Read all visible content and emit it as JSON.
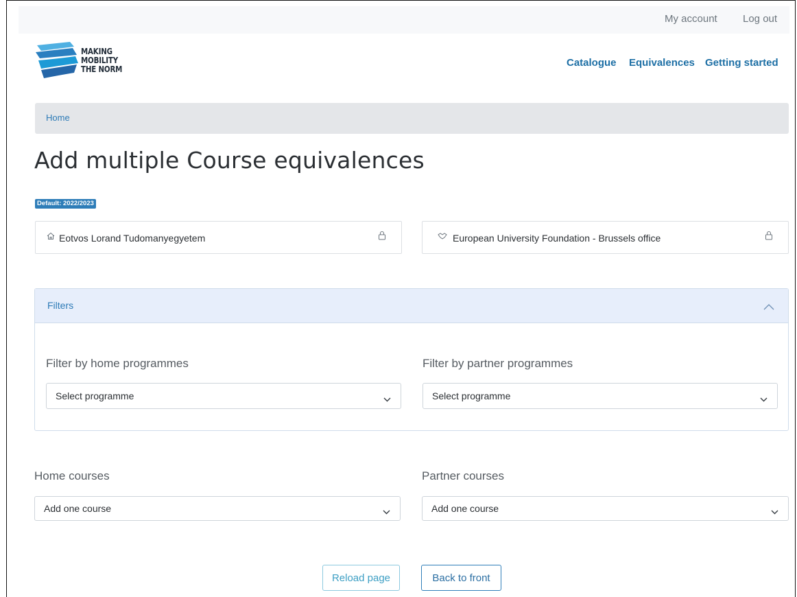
{
  "topbar": {
    "my_account": "My account",
    "log_out": "Log out"
  },
  "logo": {
    "line1": "MAKING",
    "line2": "MOBILITY",
    "line3": "THE NORM"
  },
  "nav": {
    "catalogue": "Catalogue",
    "equivalences": "Equivalences",
    "getting_started": "Getting started"
  },
  "breadcrumb": {
    "home": "Home"
  },
  "page": {
    "title": "Add multiple Course equivalences",
    "badge": "Default: 2022/2023"
  },
  "institutions": {
    "home": {
      "name": "Eotvos Lorand Tudomanyegyetem",
      "icon": "home-icon"
    },
    "partner": {
      "name": "European University Foundation - Brussels office",
      "icon": "handshake-icon"
    }
  },
  "filters": {
    "title": "Filters",
    "home_label": "Filter by home programmes",
    "home_value": "Select programme",
    "partner_label": "Filter by partner programmes",
    "partner_value": "Select programme"
  },
  "courses": {
    "home_label": "Home courses",
    "home_value": "Add one course",
    "partner_label": "Partner courses",
    "partner_value": "Add one course"
  },
  "buttons": {
    "reload": "Reload page",
    "back": "Back to front"
  },
  "colors": {
    "link": "#1d6fa5",
    "badge": "#2e7db8",
    "panel_header": "#e7eefb",
    "reload_border": "#8cc9df",
    "back_border": "#2e7db8"
  }
}
